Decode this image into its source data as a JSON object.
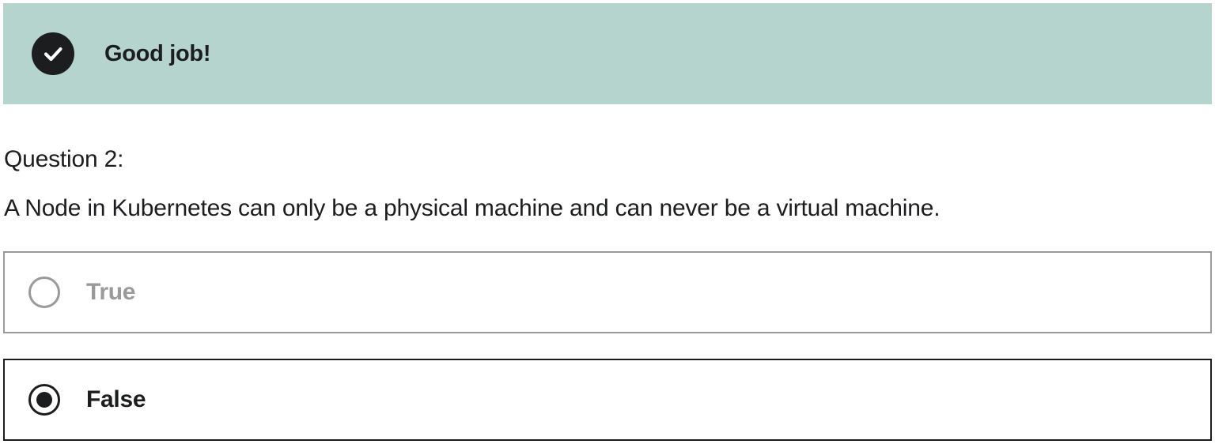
{
  "feedback": {
    "status": "correct",
    "icon": "check-circle-icon",
    "title": "Good job!",
    "background_color": "#b6d4ce"
  },
  "question": {
    "label": "Question 2:",
    "text": "A Node in Kubernetes can only be a physical machine and can never be a virtual machine."
  },
  "options": [
    {
      "label": "True",
      "selected": false
    },
    {
      "label": "False",
      "selected": true
    }
  ]
}
